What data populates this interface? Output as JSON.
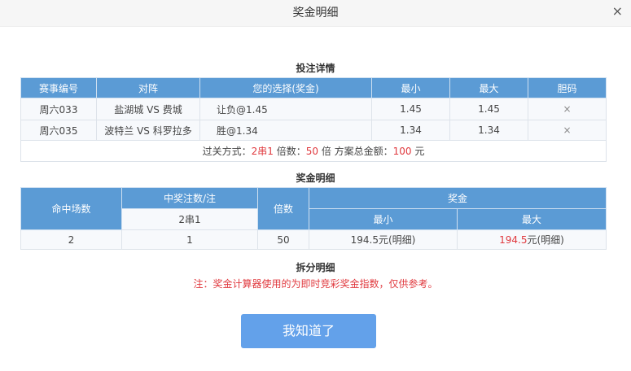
{
  "dialog": {
    "title": "奖金明细",
    "close": "×"
  },
  "bet": {
    "title": "投注详情",
    "headers": [
      "赛事编号",
      "对阵",
      "您的选择(奖金)",
      "最小",
      "最大",
      "胆码"
    ],
    "rows": [
      [
        "周六033",
        "盐湖城 VS 费城",
        "让负@1.45",
        "1.45",
        "1.45",
        "×"
      ],
      [
        "周六035",
        "波特兰 VS 科罗拉多",
        "胜@1.34",
        "1.34",
        "1.34",
        "×"
      ]
    ],
    "footer": {
      "pass_label": "过关方式：",
      "pass": "2串1",
      "mult_label": " 倍数：",
      "mult": "50",
      "mult_unit": " 倍 方案总金额：",
      "total": "100",
      "total_unit": " 元"
    }
  },
  "prize": {
    "title": "奖金明细",
    "headers": {
      "hits": "命中场数",
      "winning": "中奖注数/注",
      "sub": "2串1",
      "multiple": "倍数",
      "prize": "奖金",
      "min": "最小",
      "max": "最大"
    },
    "row": {
      "hits": "2",
      "winning": "1",
      "multiple": "50",
      "min": "194.5元(明细)",
      "max_amount": "194.5",
      "max_suffix": "元(明细)"
    }
  },
  "split": {
    "title": "拆分明细",
    "note": "注：奖金计算器使用的为即时竞彩奖金指数，仅供参考。"
  },
  "button": "我知道了"
}
